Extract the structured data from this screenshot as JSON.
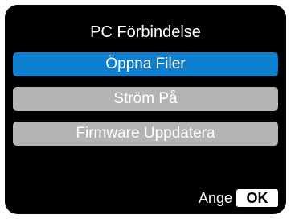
{
  "screen": {
    "title": "PC Förbindelse"
  },
  "menu": {
    "items": [
      {
        "label": "Öppna Filer",
        "selected": true
      },
      {
        "label": "Ström På",
        "selected": false
      },
      {
        "label": "Firmware Uppdatera",
        "selected": false
      }
    ]
  },
  "footer": {
    "hint_label": "Ange",
    "ok_label": "OK"
  },
  "colors": {
    "background": "#000000",
    "selected_item": "#0f7fd0",
    "unselected_item": "#b4b4b4",
    "text": "#ffffff"
  }
}
